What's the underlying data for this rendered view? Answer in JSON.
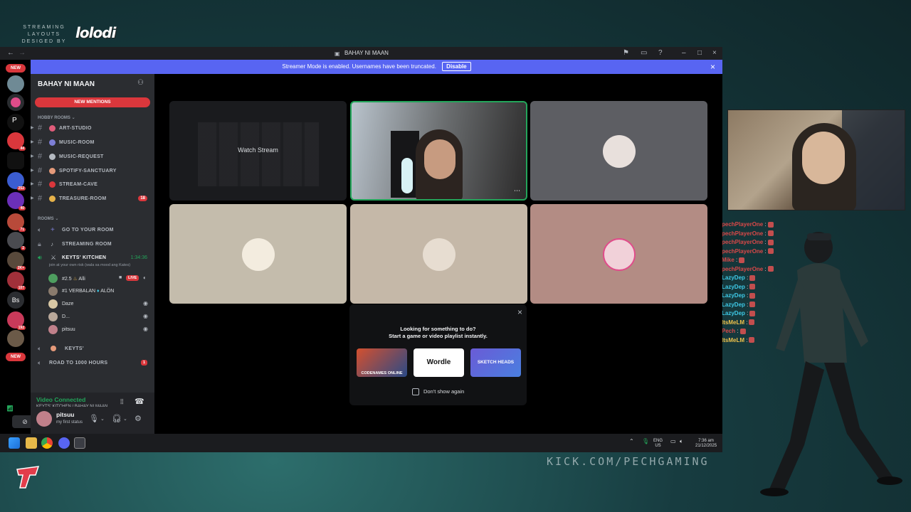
{
  "overlay": {
    "credit_line1": "STREAMING",
    "credit_line2": "LAYOUTS",
    "credit_line3": "DESIGED BY",
    "credit_logo": "lolodi",
    "kick_url": "KICK.COM/PECHGAMING"
  },
  "chat": [
    {
      "user": "pechPlayerOne",
      "color": "#d94848"
    },
    {
      "user": "pechPlayerOne",
      "color": "#d94848"
    },
    {
      "user": "pechPlayerOne",
      "color": "#d94848"
    },
    {
      "user": "pechPlayerOne",
      "color": "#d94848"
    },
    {
      "user": "Mike",
      "color": "#d94848"
    },
    {
      "user": "pechPlayerOne",
      "color": "#d94848"
    },
    {
      "user": "LazyDep",
      "color": "#3ec9e6"
    },
    {
      "user": "LazyDep",
      "color": "#3ec9e6"
    },
    {
      "user": "LazyDep",
      "color": "#3ec9e6"
    },
    {
      "user": "LazyDep",
      "color": "#3ec9e6"
    },
    {
      "user": "LazyDep",
      "color": "#3ec9e6"
    },
    {
      "user": "ItsMeLM",
      "color": "#f0c24b"
    },
    {
      "user": "Pech",
      "color": "#d94848"
    },
    {
      "user": "ItsMeLM",
      "color": "#f0c24b"
    }
  ],
  "rail": {
    "new_top": "NEW",
    "new_bottom": "NEW",
    "badges": [
      "",
      "",
      "44",
      "",
      "252",
      "40",
      "71",
      "2",
      "2K+",
      "107",
      "",
      "192"
    ],
    "bs_label": "Bs"
  },
  "window": {
    "title": "BAHAY NI MAAN",
    "notice_text": "Streamer Mode is enabled. Usernames have been truncated.",
    "notice_button": "Disable"
  },
  "sidebar": {
    "guild_name": "BAHAY NI MAAN",
    "new_mentions": "NEW MENTIONS",
    "category_hobby": "HOBBY ROOMS",
    "category_rooms": "ROOMS",
    "channels": [
      {
        "name": "ART-STUDIO",
        "badge": ""
      },
      {
        "name": "MUSIC-ROOM",
        "badge": ""
      },
      {
        "name": "MUSIC-REQUEST",
        "badge": ""
      },
      {
        "name": "SPOTIFY-SANCTUARY",
        "badge": ""
      },
      {
        "name": "STREAM-CAVE",
        "badge": ""
      },
      {
        "name": "TREASURE-ROOM",
        "badge": "18"
      }
    ],
    "voice": {
      "go_to_room": "GO TO YOUR ROOM",
      "streaming_room": "STREAMING ROOM",
      "kitchen": "KEYTS' KITCHEN",
      "kitchen_time": "1:34:36",
      "kitchen_status": "join at your own risk (wala sa mood ang Kates)",
      "members": [
        {
          "name": "#2.5",
          "extra": "Alli",
          "live": "LIVE"
        },
        {
          "name": "#1 VERBALAN",
          "extra": "ALÖN",
          "live": ""
        },
        {
          "name": "Daze",
          "extra": "",
          "live": ""
        },
        {
          "name": "D...",
          "extra": "",
          "live": ""
        },
        {
          "name": "pitsuu",
          "extra": "",
          "live": ""
        }
      ],
      "keyts": "KEYTS'",
      "road": "ROAD TO 1000 HOURS",
      "road_badge": "1"
    },
    "voice_panel": {
      "status": "Video Connected",
      "location": "KEYTS' KITCHEN / BAHAY NI MAAN"
    },
    "user": {
      "name": "pitsuu",
      "status": "my first status"
    }
  },
  "stage": {
    "watch_stream": "Watch Stream",
    "activity": {
      "title": "Looking for something to do?",
      "subtitle": "Start a game or video playlist instantly.",
      "cards": [
        "CODENAMES ONLINE",
        "Wordle",
        "SKETCH HEADS"
      ],
      "checkbox_label": "Don't show again"
    }
  },
  "taskbar": {
    "lang_top": "ENG",
    "lang_bottom": "US",
    "time": "7:36 am",
    "date": "21/12/2025"
  },
  "colors": {
    "accent": "#5865f2",
    "danger": "#da373c",
    "online": "#23a55a"
  }
}
